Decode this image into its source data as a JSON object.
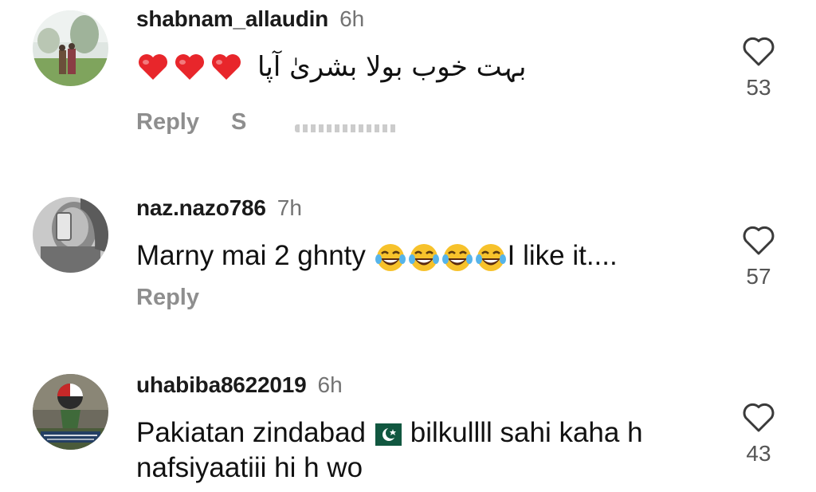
{
  "comments": [
    {
      "username": "shabnam_allaudin",
      "time": "6h",
      "text": "بہت خوب بولا بشریٰ آپا",
      "reply_label": "Reply",
      "see_more_label": "S",
      "likes": "53",
      "avatar_icon": "photo-avatar"
    },
    {
      "username": "naz.nazo786",
      "time": "7h",
      "text_before": "Marny mai 2 ghnty ",
      "text_after": "I like it....",
      "reply_label": "Reply",
      "likes": "57",
      "avatar_icon": "photo-avatar"
    },
    {
      "username": "uhabiba8622019",
      "time": "6h",
      "text_line1_before": "Pakiatan zindabad",
      "text_line1_after": " bilkullll sahi kaha h",
      "text_line2": "nafsiyaatiii hi h wo",
      "likes": "43",
      "avatar_icon": "photo-avatar"
    }
  ],
  "icons": {
    "like": "heart-outline-icon",
    "heart_emoji": "red-heart-emoji",
    "laugh_emoji": "tears-of-joy-emoji",
    "flag_emoji": "pakistan-flag-emoji"
  },
  "colors": {
    "username": "#1a1a1a",
    "muted": "#8e8e8e",
    "heart_red": "#e0245e",
    "emoji_yellow": "#f7c22b",
    "flag_green": "#115740"
  }
}
